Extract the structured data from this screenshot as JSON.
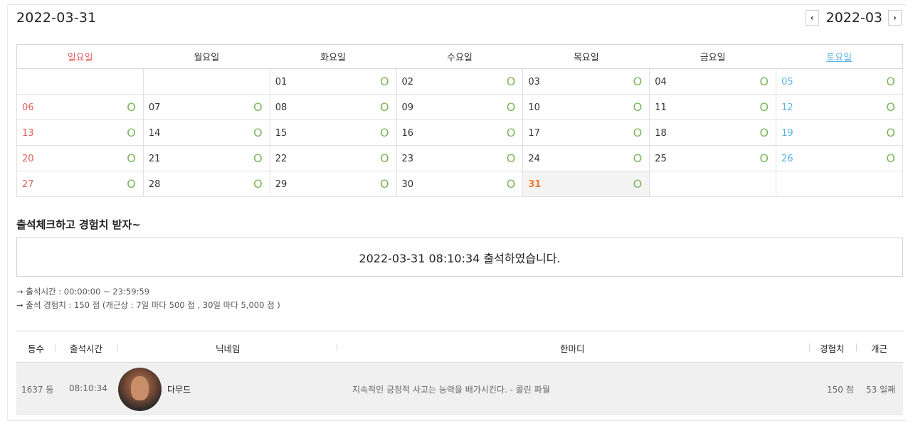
{
  "header": {
    "date": "2022-03-31",
    "month": "2022-03",
    "prev_icon": "chevron-left-icon",
    "next_icon": "chevron-right-icon",
    "prev_glyph": "‹",
    "next_glyph": "›"
  },
  "calendar": {
    "weekdays": [
      "일요일",
      "월요일",
      "화요일",
      "수요일",
      "목요일",
      "금요일",
      "토요일"
    ],
    "mark": "O",
    "today": "31",
    "colors": {
      "sunday": "#e4605e",
      "saturday": "#5ab0e6",
      "mark": "#7cb65a",
      "today": "#f07c2e"
    },
    "weeks": [
      [
        "",
        "",
        "01",
        "02",
        "03",
        "04",
        "05"
      ],
      [
        "06",
        "07",
        "08",
        "09",
        "10",
        "11",
        "12"
      ],
      [
        "13",
        "14",
        "15",
        "16",
        "17",
        "18",
        "19"
      ],
      [
        "20",
        "21",
        "22",
        "23",
        "24",
        "25",
        "26"
      ],
      [
        "27",
        "28",
        "29",
        "30",
        "31",
        "",
        ""
      ]
    ]
  },
  "attendance": {
    "section_title": "출석체크하고 경험치 받자~",
    "message": "2022-03-31 08:10:34 출석하였습니다.",
    "time_info": "→ 출석시간 : 00:00:00 ~ 23:59:59",
    "exp_info": "→ 출석 경험치 : 150 점 (개근상 : 7일 마다 500 점 , 30일 마다 5,000 점 )"
  },
  "list": {
    "columns": {
      "rank": "등수",
      "time": "출석시간",
      "nickname": "닉네임",
      "comment": "한마디",
      "exp": "경험치",
      "streak": "개근"
    },
    "rows": [
      {
        "rank": "1637 등",
        "time": "08:10:34",
        "nickname": "다무드",
        "comment": "지속적인 긍정적 사고는 능력을 배가시킨다. - 콜린 파월",
        "exp": "150 점",
        "streak": "53 일째"
      }
    ]
  }
}
